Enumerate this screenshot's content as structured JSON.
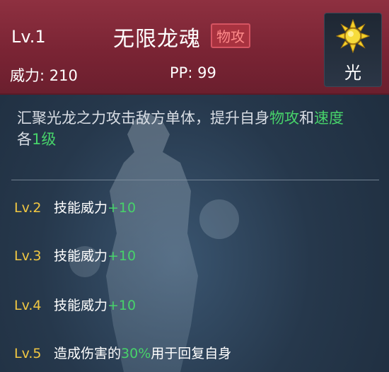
{
  "header": {
    "level": "Lv.1",
    "skill_name": "无限龙魂",
    "category_tag": "物攻",
    "power_text": "威力: 210",
    "pp_text": "PP: 99",
    "element_label": "光",
    "element_icon": "sun-icon"
  },
  "description": {
    "part1": "汇聚光龙之力攻击敌方单体，提升自身",
    "hl1": "物攻",
    "part2": "和",
    "hl2": "速度",
    "part3": "各",
    "hl3": "1级"
  },
  "upgrades": [
    {
      "level": "Lv.2",
      "text": "技能威力",
      "bonus": "+10"
    },
    {
      "level": "Lv.3",
      "text": "技能威力",
      "bonus": "+10"
    },
    {
      "level": "Lv.4",
      "text": "技能威力",
      "bonus": "+10"
    },
    {
      "level": "Lv.5",
      "text": "造成伤害的",
      "bonus": "30%",
      "text2": "用于回复自身"
    }
  ],
  "colors": {
    "header_bg": "#7a2434",
    "tag_bg": "#a8323f",
    "highlight_green": "#47d36a",
    "level_yellow": "#f2c842"
  }
}
